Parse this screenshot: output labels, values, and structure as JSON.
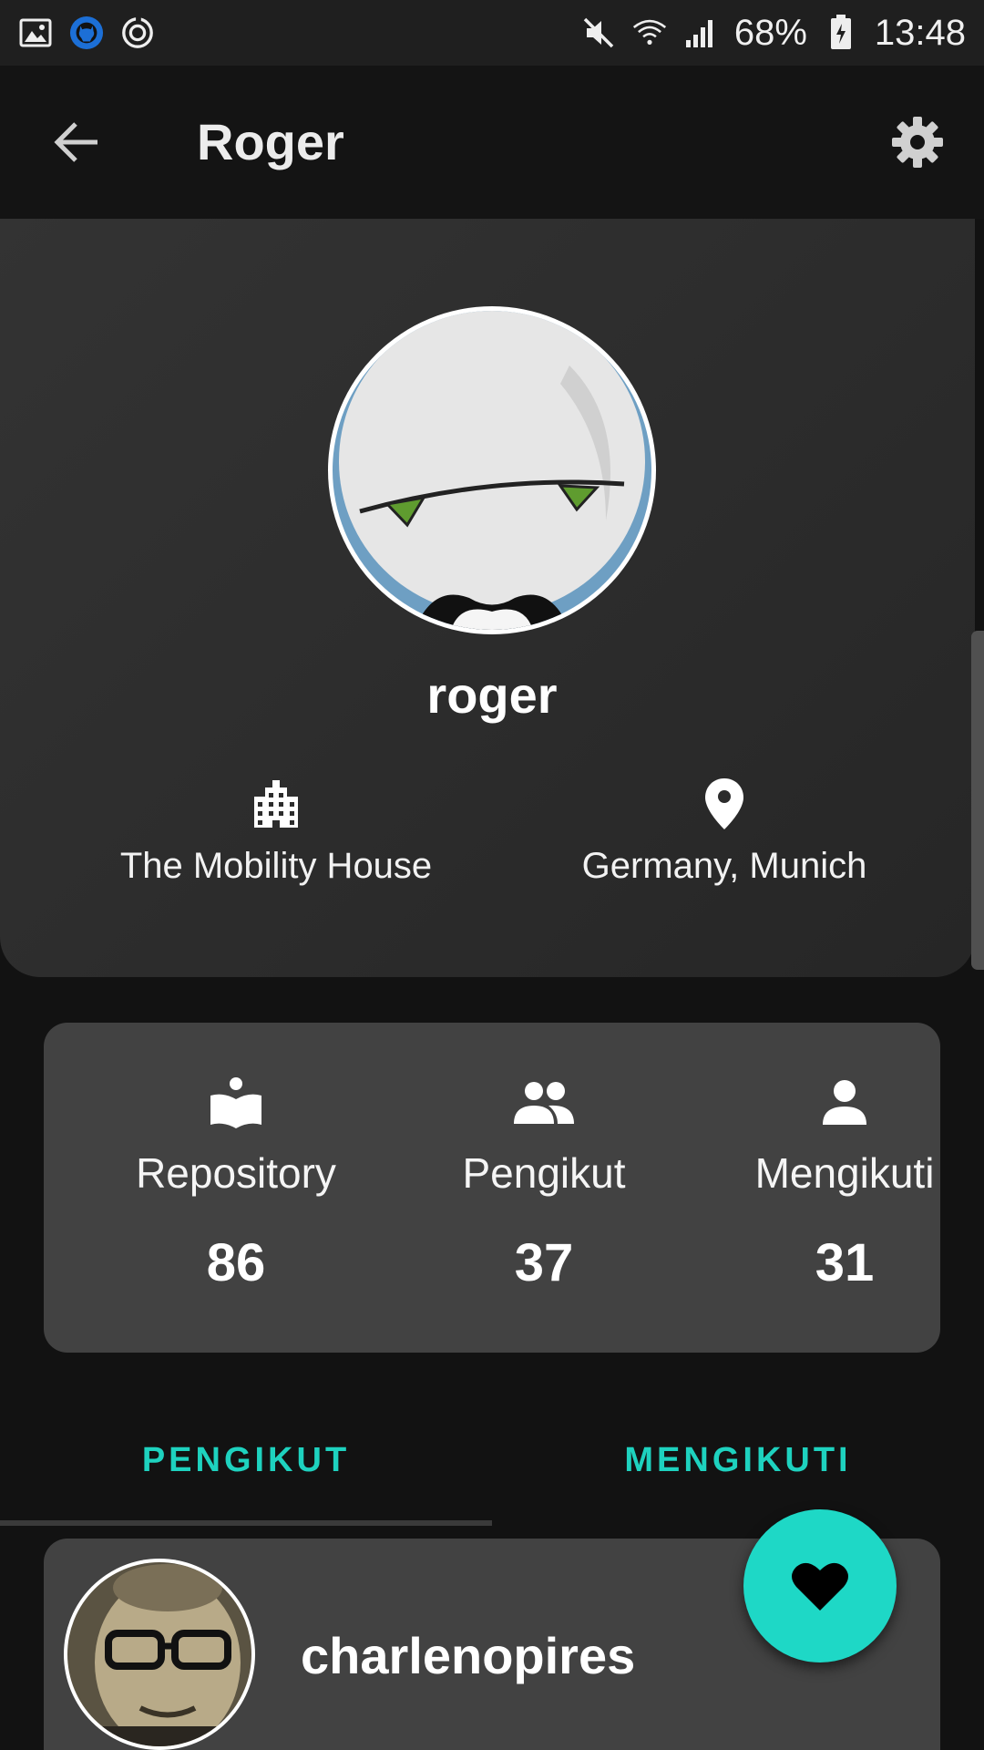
{
  "status_bar": {
    "battery": "68%",
    "time": "13:48",
    "icons_left": [
      "image-icon",
      "github-icon",
      "sync-icon"
    ],
    "icons_right": [
      "mute-icon",
      "wifi-icon",
      "signal-icon",
      "battery-icon"
    ]
  },
  "app_bar": {
    "title": "Roger",
    "back_icon": "arrow-left-icon",
    "settings_icon": "gear-icon"
  },
  "profile": {
    "username": "roger",
    "company": "The Mobility House",
    "location": "Germany, Munich",
    "company_icon": "building-icon",
    "location_icon": "map-pin-icon"
  },
  "stats": [
    {
      "label": "Repository",
      "value": "86",
      "icon": "book-icon"
    },
    {
      "label": "Pengikut",
      "value": "37",
      "icon": "people-icon"
    },
    {
      "label": "Mengikuti",
      "value": "31",
      "icon": "person-icon"
    }
  ],
  "tabs": [
    {
      "label": "PENGIKUT",
      "selected": true
    },
    {
      "label": "MENGIKUTI",
      "selected": false
    }
  ],
  "followers": [
    {
      "username": "charlenopires"
    }
  ],
  "fab": {
    "icon": "heart-icon"
  },
  "colors": {
    "accent": "#1ed2bf",
    "fab": "#1ed8c6",
    "background": "#121212",
    "card": "#424242"
  }
}
